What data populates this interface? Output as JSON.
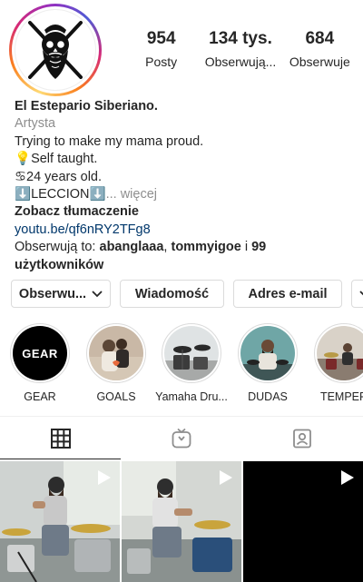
{
  "profile": {
    "stats": [
      {
        "value": "954",
        "label": "Posty"
      },
      {
        "value": "134 tys.",
        "label": "Obserwują..."
      },
      {
        "value": "684",
        "label": "Obserwuje"
      }
    ]
  },
  "bio": {
    "name": "El Estepario Siberiano.",
    "category": "Artysta",
    "line1": "Trying to make my mama proud.",
    "line2_emoji": "💡",
    "line2": "Self taught.",
    "line3_emoji": "♋",
    "line3": "24 years old.",
    "line4_emoji_left": "⬇️",
    "line4": "LECCION",
    "line4_emoji_right": "⬇️",
    "more": "... więcej",
    "translate": "Zobacz tłumaczenie",
    "link": "youtu.be/qf6nRY2TFg8",
    "followed_prefix": "Obserwują to: ",
    "followed_user1": "abanglaaa",
    "followed_sep": ", ",
    "followed_user2": "tommyigoe",
    "followed_and": " i ",
    "followed_rest": "99 użytkowników"
  },
  "buttons": {
    "follow": "Obserwu...",
    "message": "Wiadomość",
    "email": "Adres e-mail"
  },
  "highlights": [
    {
      "label": "GEAR",
      "cover_text": "GEAR"
    },
    {
      "label": "GOALS"
    },
    {
      "label": "Yamaha Dru..."
    },
    {
      "label": "DUDAS"
    },
    {
      "label": "TEMPER"
    }
  ],
  "tabs": [
    {
      "icon": "grid-icon",
      "active": true
    },
    {
      "icon": "igtv-icon",
      "active": false
    },
    {
      "icon": "tagged-icon",
      "active": false
    }
  ],
  "posts": [
    {
      "type": "video"
    },
    {
      "type": "video"
    },
    {
      "type": "video"
    }
  ],
  "colors": {
    "text": "#262626",
    "muted": "#8e8e8e",
    "link": "#00376b",
    "border": "#dbdbdb"
  }
}
